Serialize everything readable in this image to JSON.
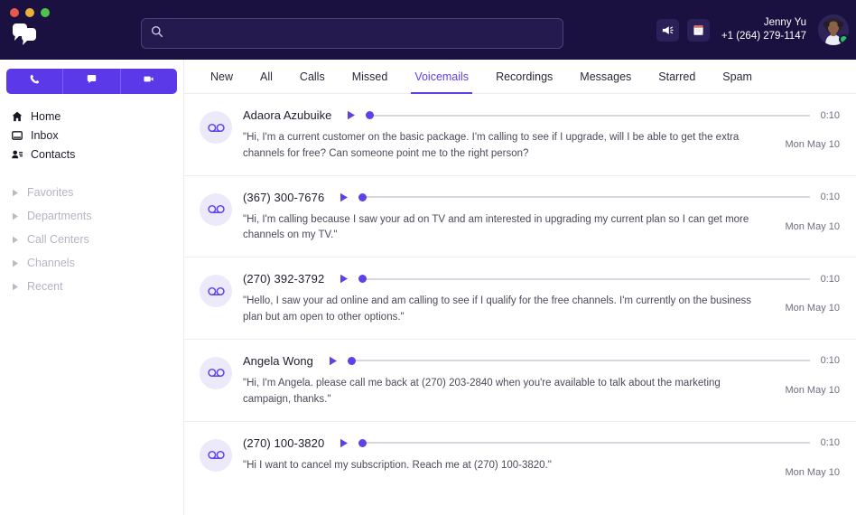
{
  "window": {
    "traffic_lights": [
      "close",
      "minimize",
      "maximize"
    ],
    "logo_name": "chat-bubbles-logo"
  },
  "header": {
    "search": {
      "value": "",
      "placeholder": "",
      "icon": "search-icon"
    },
    "icons": [
      {
        "name": "announcement-icon",
        "label": "Announcements"
      },
      {
        "name": "notepad-icon",
        "label": "Notes"
      }
    ],
    "user": {
      "name": "Jenny Yu",
      "phone": "+1 (264) 279-1147",
      "status": "online"
    },
    "colors": {
      "background": "#1b1140",
      "accent": "#6040e8"
    }
  },
  "sidebar": {
    "actions": [
      {
        "name": "new-call-button",
        "icon": "phone-icon"
      },
      {
        "name": "new-message-button",
        "icon": "message-icon"
      },
      {
        "name": "new-video-button",
        "icon": "video-icon"
      }
    ],
    "items": [
      {
        "label": "Home",
        "icon": "home-icon"
      },
      {
        "label": "Inbox",
        "icon": "inbox-icon"
      },
      {
        "label": "Contacts",
        "icon": "contacts-icon"
      }
    ],
    "groups": [
      {
        "label": "Favorites"
      },
      {
        "label": "Departments"
      },
      {
        "label": "Call Centers"
      },
      {
        "label": "Channels"
      },
      {
        "label": "Recent"
      }
    ]
  },
  "main": {
    "tabs": [
      {
        "label": "New",
        "active": false
      },
      {
        "label": "All",
        "active": false
      },
      {
        "label": "Calls",
        "active": false
      },
      {
        "label": "Missed",
        "active": false
      },
      {
        "label": "Voicemails",
        "active": true
      },
      {
        "label": "Recordings",
        "active": false
      },
      {
        "label": "Messages",
        "active": false
      },
      {
        "label": "Starred",
        "active": false
      },
      {
        "label": "Spam",
        "active": false
      }
    ],
    "voicemails": [
      {
        "name": "Adaora Azubuike",
        "is_phone": false,
        "duration": "0:10",
        "date": "Mon May 10",
        "transcript": "\"Hi, I'm a current customer on the basic package. I'm calling to see if I upgrade, will I be able to get the extra channels for free? Can someone point me to the right person?"
      },
      {
        "name": "(367) 300-7676",
        "is_phone": true,
        "duration": "0:10",
        "date": "Mon May 10",
        "transcript": "\"Hi, I'm calling because I saw your ad on TV and am interested in upgrading my current plan so I can get more channels on my TV.\""
      },
      {
        "name": "(270) 392-3792",
        "is_phone": true,
        "duration": "0:10",
        "date": "Mon May 10",
        "transcript": "\"Hello, I saw your ad online and am calling to see if I qualify for the free channels. I'm currently on the business plan but am open to other options.\""
      },
      {
        "name": "Angela Wong",
        "is_phone": false,
        "duration": "0:10",
        "date": "Mon May 10",
        "transcript": "\"Hi, I'm Angela. please call me back at (270) 203-2840 when you're available to talk about the marketing campaign, thanks.\""
      },
      {
        "name": "(270) 100-3820",
        "is_phone": true,
        "duration": "0:10",
        "date": "Mon May 10",
        "transcript": "\"Hi I want to cancel my subscription. Reach me at (270) 100-3820.\""
      }
    ]
  }
}
